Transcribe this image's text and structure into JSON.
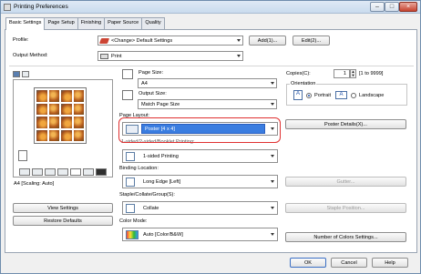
{
  "window": {
    "title": "Printing Preferences",
    "minimize": "–",
    "maximize": "□",
    "close": "×"
  },
  "tabs": [
    "Basic Settings",
    "Page Setup",
    "Finishing",
    "Paper Source",
    "Quality"
  ],
  "profile": {
    "label": "Profile:",
    "value": "<Change> Default Settings",
    "add": "Add(1)...",
    "edit": "Edit(2)..."
  },
  "output": {
    "label": "Output Method:",
    "value": "Print"
  },
  "preview": {
    "caption": "A4 [Scaling: Auto]",
    "view_settings": "View Settings",
    "restore": "Restore Defaults"
  },
  "page_size": {
    "label": "Page Size:",
    "value": "A4"
  },
  "output_size": {
    "label": "Output Size:",
    "value": "Match Page Size"
  },
  "page_layout": {
    "label": "Page Layout:",
    "value": "Poster [4 x 4]",
    "hidden_label": "1-sided/2-sided/Booklet Printing:"
  },
  "printing": {
    "value": "1-sided Printing"
  },
  "binding": {
    "label": "Binding Location:",
    "value": "Long Edge [Left]"
  },
  "staple": {
    "label": "Staple/Collate/Group(S):",
    "value": "Collate"
  },
  "color_mode": {
    "label": "Color Mode:",
    "value": "Auto [Color/B&W]"
  },
  "copies": {
    "label": "Copies(C):",
    "value": "1",
    "range": "[1 to 9999]"
  },
  "orientation": {
    "label": "Orientation",
    "portrait": "Portrait",
    "landscape": "Landscape"
  },
  "right_buttons": {
    "poster": "Poster Details(X)...",
    "gutter": "Gutter...",
    "staple": "Staple Position...",
    "colors": "Number of Colors Settings..."
  },
  "footer": {
    "ok": "OK",
    "cancel": "Cancel",
    "help": "Help"
  },
  "colors": {
    "accent": "#3a7de0",
    "highlight": "#e03030"
  }
}
